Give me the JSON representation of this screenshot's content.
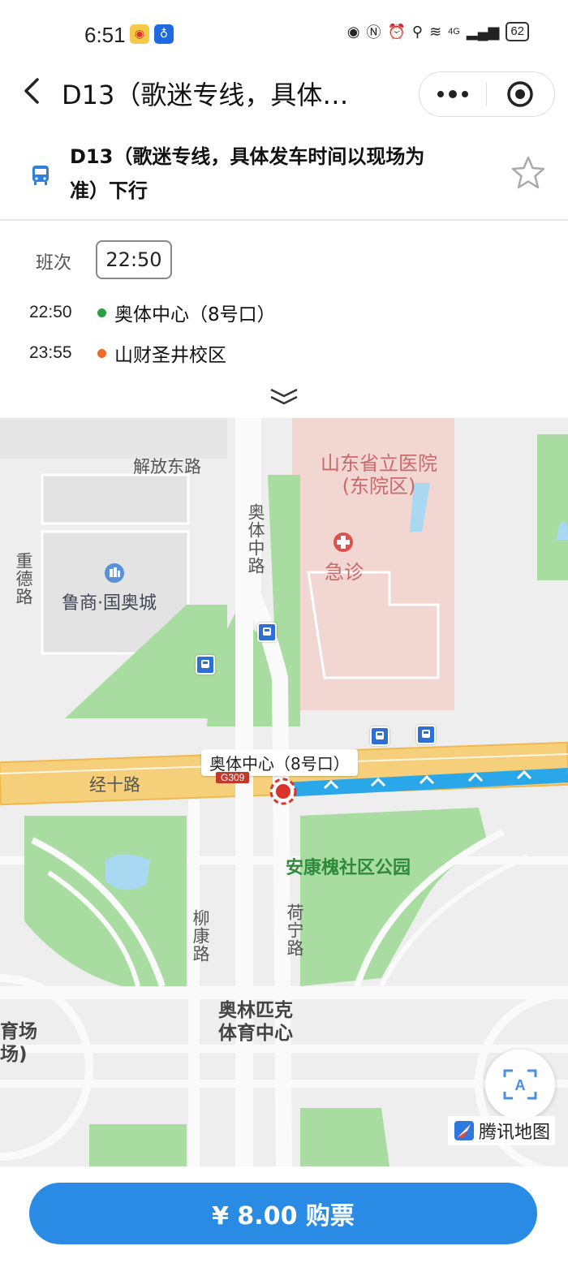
{
  "status_bar": {
    "time": "6:51",
    "battery": "62",
    "network": "4G"
  },
  "nav": {
    "title": "D13（歌迷专线，具体…"
  },
  "route": {
    "name": "D13（歌迷专线，具体发车时间以现场为准）下行"
  },
  "schedule": {
    "trip_label": "班次",
    "trip_time": "22:50",
    "stops": [
      {
        "time": "22:50",
        "name": "奥体中心（8号口）",
        "color": "#2e9e45"
      },
      {
        "time": "23:55",
        "name": "山财圣井校区",
        "color": "#ee6a2a"
      }
    ]
  },
  "map": {
    "roads": [
      "解放东路",
      "奥体中路",
      "重德路",
      "经十路",
      "柳康路",
      "荷宁路"
    ],
    "pois": {
      "hospital": "山东省立医院(东院区)",
      "emergency": "急诊",
      "mall": "鲁商·国奥城",
      "park": "安康槐社区公园",
      "stadium": "奥林匹克体育中心",
      "stadium_left": "育场场)"
    },
    "stop_label": "奥体中心（8号口）",
    "highway_shield": "G309",
    "logo": "腾讯地图",
    "colors": {
      "route": "#2aa7e8",
      "highway": "#f5cf7a",
      "green": "#a8dca0",
      "hospital": "#f1d6d2"
    }
  },
  "footer": {
    "buy_label": "¥ 8.00 购票"
  }
}
